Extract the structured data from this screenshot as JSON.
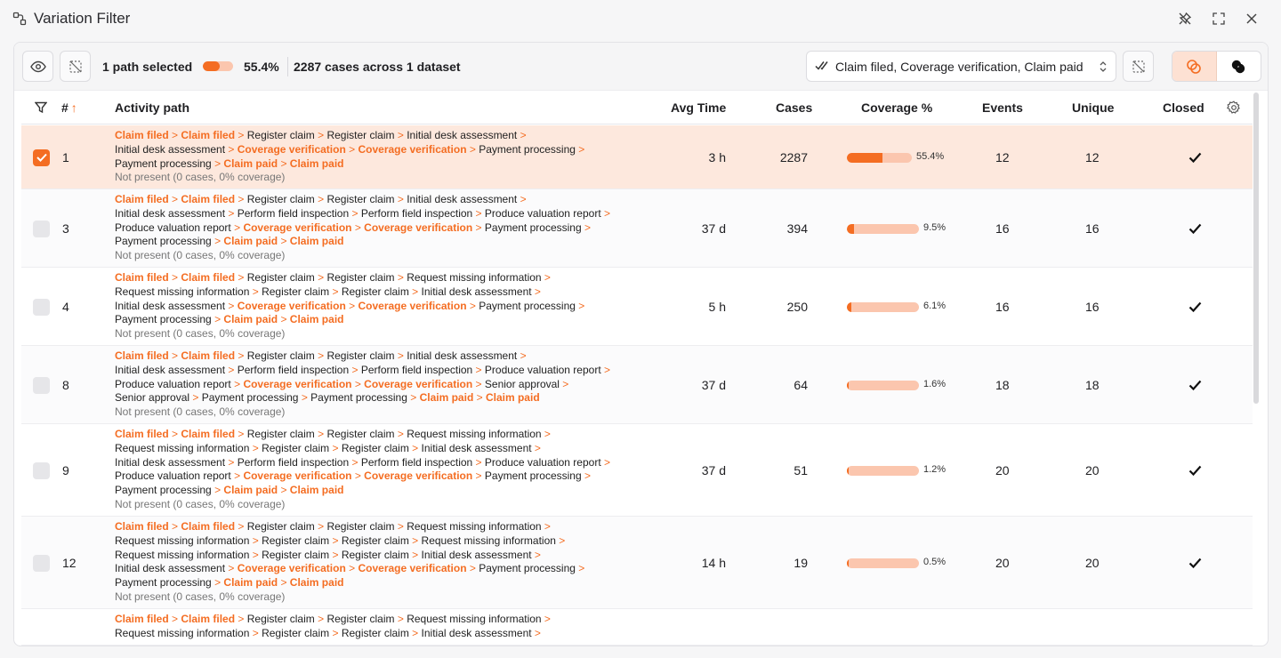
{
  "window": {
    "title": "Variation Filter"
  },
  "toolbar": {
    "selection": "1 path selected",
    "selection_fraction": 0.554,
    "percent": "55.4%",
    "cases_summary": "2287 cases across 1 dataset",
    "activity_filter": "Claim filed, Coverage verification, Claim paid"
  },
  "columns": {
    "num": "#",
    "path": "Activity path",
    "avg": "Avg Time",
    "cases": "Cases",
    "coverage": "Coverage %",
    "events": "Events",
    "unique": "Unique",
    "closed": "Closed"
  },
  "colors": {
    "accent": "#f46d22",
    "accent_light": "#fbc6ae",
    "selected_row": "#fde8dd"
  },
  "rows": [
    {
      "num": "1",
      "avg": "3 h",
      "cases": "2287",
      "coverage": "55.4%",
      "coverage_fraction": 0.554,
      "events": "12",
      "unique": "12",
      "checked": true,
      "path_lines": [
        [
          [
            "o",
            "Claim filed"
          ],
          [
            "g",
            " > "
          ],
          [
            "o",
            "Claim filed"
          ],
          [
            "g",
            " > "
          ],
          [
            "n",
            "Register claim"
          ],
          [
            "g",
            " > "
          ],
          [
            "n",
            "Register claim"
          ],
          [
            "g",
            " > "
          ],
          [
            "n",
            "Initial desk assessment"
          ],
          [
            "g",
            " >"
          ]
        ],
        [
          [
            "n",
            "Initial desk assessment"
          ],
          [
            "g",
            " > "
          ],
          [
            "o",
            "Coverage verification"
          ],
          [
            "g",
            " > "
          ],
          [
            "o",
            "Coverage verification"
          ],
          [
            "g",
            " > "
          ],
          [
            "n",
            "Payment processing"
          ],
          [
            "g",
            " >"
          ]
        ],
        [
          [
            "n",
            "Payment processing"
          ],
          [
            "g",
            " > "
          ],
          [
            "o",
            "Claim paid"
          ],
          [
            "g",
            " > "
          ],
          [
            "o",
            "Claim paid"
          ]
        ]
      ],
      "not_present": "Not present (0 cases, 0% coverage)"
    },
    {
      "num": "3",
      "avg": "37 d",
      "cases": "394",
      "coverage": "9.5%",
      "coverage_fraction": 0.095,
      "events": "16",
      "unique": "16",
      "checked": false,
      "path_lines": [
        [
          [
            "o",
            "Claim filed"
          ],
          [
            "g",
            " > "
          ],
          [
            "o",
            "Claim filed"
          ],
          [
            "g",
            " > "
          ],
          [
            "n",
            "Register claim"
          ],
          [
            "g",
            " > "
          ],
          [
            "n",
            "Register claim"
          ],
          [
            "g",
            " > "
          ],
          [
            "n",
            "Initial desk assessment"
          ],
          [
            "g",
            " >"
          ]
        ],
        [
          [
            "n",
            "Initial desk assessment"
          ],
          [
            "g",
            " > "
          ],
          [
            "n",
            "Perform field inspection"
          ],
          [
            "g",
            " > "
          ],
          [
            "n",
            "Perform field inspection"
          ],
          [
            "g",
            " > "
          ],
          [
            "n",
            "Produce valuation report"
          ],
          [
            "g",
            " >"
          ]
        ],
        [
          [
            "n",
            "Produce valuation report"
          ],
          [
            "g",
            " > "
          ],
          [
            "o",
            "Coverage verification"
          ],
          [
            "g",
            " > "
          ],
          [
            "o",
            "Coverage verification"
          ],
          [
            "g",
            " > "
          ],
          [
            "n",
            "Payment processing"
          ],
          [
            "g",
            " >"
          ]
        ],
        [
          [
            "n",
            "Payment processing"
          ],
          [
            "g",
            " > "
          ],
          [
            "o",
            "Claim paid"
          ],
          [
            "g",
            " > "
          ],
          [
            "o",
            "Claim paid"
          ]
        ]
      ],
      "not_present": "Not present (0 cases, 0% coverage)"
    },
    {
      "num": "4",
      "avg": "5 h",
      "cases": "250",
      "coverage": "6.1%",
      "coverage_fraction": 0.061,
      "events": "16",
      "unique": "16",
      "checked": false,
      "path_lines": [
        [
          [
            "o",
            "Claim filed"
          ],
          [
            "g",
            " > "
          ],
          [
            "o",
            "Claim filed"
          ],
          [
            "g",
            " > "
          ],
          [
            "n",
            "Register claim"
          ],
          [
            "g",
            " > "
          ],
          [
            "n",
            "Register claim"
          ],
          [
            "g",
            " > "
          ],
          [
            "n",
            "Request missing information"
          ],
          [
            "g",
            " >"
          ]
        ],
        [
          [
            "n",
            "Request missing information"
          ],
          [
            "g",
            " > "
          ],
          [
            "n",
            "Register claim"
          ],
          [
            "g",
            " > "
          ],
          [
            "n",
            "Register claim"
          ],
          [
            "g",
            " > "
          ],
          [
            "n",
            "Initial desk assessment"
          ],
          [
            "g",
            " >"
          ]
        ],
        [
          [
            "n",
            "Initial desk assessment"
          ],
          [
            "g",
            " > "
          ],
          [
            "o",
            "Coverage verification"
          ],
          [
            "g",
            " > "
          ],
          [
            "o",
            "Coverage verification"
          ],
          [
            "g",
            " > "
          ],
          [
            "n",
            "Payment processing"
          ],
          [
            "g",
            " >"
          ]
        ],
        [
          [
            "n",
            "Payment processing"
          ],
          [
            "g",
            " > "
          ],
          [
            "o",
            "Claim paid"
          ],
          [
            "g",
            " > "
          ],
          [
            "o",
            "Claim paid"
          ]
        ]
      ],
      "not_present": "Not present (0 cases, 0% coverage)"
    },
    {
      "num": "8",
      "avg": "37 d",
      "cases": "64",
      "coverage": "1.6%",
      "coverage_fraction": 0.016,
      "events": "18",
      "unique": "18",
      "checked": false,
      "path_lines": [
        [
          [
            "o",
            "Claim filed"
          ],
          [
            "g",
            " > "
          ],
          [
            "o",
            "Claim filed"
          ],
          [
            "g",
            " > "
          ],
          [
            "n",
            "Register claim"
          ],
          [
            "g",
            " > "
          ],
          [
            "n",
            "Register claim"
          ],
          [
            "g",
            " > "
          ],
          [
            "n",
            "Initial desk assessment"
          ],
          [
            "g",
            " >"
          ]
        ],
        [
          [
            "n",
            "Initial desk assessment"
          ],
          [
            "g",
            " > "
          ],
          [
            "n",
            "Perform field inspection"
          ],
          [
            "g",
            " > "
          ],
          [
            "n",
            "Perform field inspection"
          ],
          [
            "g",
            " > "
          ],
          [
            "n",
            "Produce valuation report"
          ],
          [
            "g",
            " >"
          ]
        ],
        [
          [
            "n",
            "Produce valuation report"
          ],
          [
            "g",
            " > "
          ],
          [
            "o",
            "Coverage verification"
          ],
          [
            "g",
            " > "
          ],
          [
            "o",
            "Coverage verification"
          ],
          [
            "g",
            " > "
          ],
          [
            "n",
            "Senior approval"
          ],
          [
            "g",
            " >"
          ]
        ],
        [
          [
            "n",
            "Senior approval"
          ],
          [
            "g",
            " > "
          ],
          [
            "n",
            "Payment processing"
          ],
          [
            "g",
            " > "
          ],
          [
            "n",
            "Payment processing"
          ],
          [
            "g",
            " > "
          ],
          [
            "o",
            "Claim paid"
          ],
          [
            "g",
            " > "
          ],
          [
            "o",
            "Claim paid"
          ]
        ]
      ],
      "not_present": "Not present (0 cases, 0% coverage)"
    },
    {
      "num": "9",
      "avg": "37 d",
      "cases": "51",
      "coverage": "1.2%",
      "coverage_fraction": 0.012,
      "events": "20",
      "unique": "20",
      "checked": false,
      "path_lines": [
        [
          [
            "o",
            "Claim filed"
          ],
          [
            "g",
            " > "
          ],
          [
            "o",
            "Claim filed"
          ],
          [
            "g",
            " > "
          ],
          [
            "n",
            "Register claim"
          ],
          [
            "g",
            " > "
          ],
          [
            "n",
            "Register claim"
          ],
          [
            "g",
            " > "
          ],
          [
            "n",
            "Request missing information"
          ],
          [
            "g",
            " >"
          ]
        ],
        [
          [
            "n",
            "Request missing information"
          ],
          [
            "g",
            " > "
          ],
          [
            "n",
            "Register claim"
          ],
          [
            "g",
            " > "
          ],
          [
            "n",
            "Register claim"
          ],
          [
            "g",
            " > "
          ],
          [
            "n",
            "Initial desk assessment"
          ],
          [
            "g",
            " >"
          ]
        ],
        [
          [
            "n",
            "Initial desk assessment"
          ],
          [
            "g",
            " > "
          ],
          [
            "n",
            "Perform field inspection"
          ],
          [
            "g",
            " > "
          ],
          [
            "n",
            "Perform field inspection"
          ],
          [
            "g",
            " > "
          ],
          [
            "n",
            "Produce valuation report"
          ],
          [
            "g",
            " >"
          ]
        ],
        [
          [
            "n",
            "Produce valuation report"
          ],
          [
            "g",
            " > "
          ],
          [
            "o",
            "Coverage verification"
          ],
          [
            "g",
            " > "
          ],
          [
            "o",
            "Coverage verification"
          ],
          [
            "g",
            " > "
          ],
          [
            "n",
            "Payment processing"
          ],
          [
            "g",
            " >"
          ]
        ],
        [
          [
            "n",
            "Payment processing"
          ],
          [
            "g",
            " > "
          ],
          [
            "o",
            "Claim paid"
          ],
          [
            "g",
            " > "
          ],
          [
            "o",
            "Claim paid"
          ]
        ]
      ],
      "not_present": "Not present (0 cases, 0% coverage)"
    },
    {
      "num": "12",
      "avg": "14 h",
      "cases": "19",
      "coverage": "0.5%",
      "coverage_fraction": 0.005,
      "events": "20",
      "unique": "20",
      "checked": false,
      "path_lines": [
        [
          [
            "o",
            "Claim filed"
          ],
          [
            "g",
            " > "
          ],
          [
            "o",
            "Claim filed"
          ],
          [
            "g",
            " > "
          ],
          [
            "n",
            "Register claim"
          ],
          [
            "g",
            " > "
          ],
          [
            "n",
            "Register claim"
          ],
          [
            "g",
            " > "
          ],
          [
            "n",
            "Request missing information"
          ],
          [
            "g",
            " >"
          ]
        ],
        [
          [
            "n",
            "Request missing information"
          ],
          [
            "g",
            " > "
          ],
          [
            "n",
            "Register claim"
          ],
          [
            "g",
            " > "
          ],
          [
            "n",
            "Register claim"
          ],
          [
            "g",
            " > "
          ],
          [
            "n",
            "Request missing information"
          ],
          [
            "g",
            " >"
          ]
        ],
        [
          [
            "n",
            "Request missing information"
          ],
          [
            "g",
            " > "
          ],
          [
            "n",
            "Register claim"
          ],
          [
            "g",
            " > "
          ],
          [
            "n",
            "Register claim"
          ],
          [
            "g",
            " > "
          ],
          [
            "n",
            "Initial desk assessment"
          ],
          [
            "g",
            " >"
          ]
        ],
        [
          [
            "n",
            "Initial desk assessment"
          ],
          [
            "g",
            " > "
          ],
          [
            "o",
            "Coverage verification"
          ],
          [
            "g",
            " > "
          ],
          [
            "o",
            "Coverage verification"
          ],
          [
            "g",
            " > "
          ],
          [
            "n",
            "Payment processing"
          ],
          [
            "g",
            " >"
          ]
        ],
        [
          [
            "n",
            "Payment processing"
          ],
          [
            "g",
            " > "
          ],
          [
            "o",
            "Claim paid"
          ],
          [
            "g",
            " > "
          ],
          [
            "o",
            "Claim paid"
          ]
        ]
      ],
      "not_present": "Not present (0 cases, 0% coverage)"
    },
    {
      "num": "",
      "avg": "",
      "cases": "",
      "coverage": "",
      "coverage_fraction": null,
      "events": "",
      "unique": "",
      "checked": false,
      "partial": true,
      "path_lines": [
        [
          [
            "o",
            "Claim filed"
          ],
          [
            "g",
            " > "
          ],
          [
            "o",
            "Claim filed"
          ],
          [
            "g",
            " > "
          ],
          [
            "n",
            "Register claim"
          ],
          [
            "g",
            " > "
          ],
          [
            "n",
            "Register claim"
          ],
          [
            "g",
            " > "
          ],
          [
            "n",
            "Request missing information"
          ],
          [
            "g",
            " >"
          ]
        ],
        [
          [
            "n",
            "Request missing information"
          ],
          [
            "g",
            " > "
          ],
          [
            "n",
            "Register claim"
          ],
          [
            "g",
            " > "
          ],
          [
            "n",
            "Register claim"
          ],
          [
            "g",
            " > "
          ],
          [
            "n",
            "Initial desk assessment"
          ],
          [
            "g",
            " >"
          ]
        ]
      ],
      "not_present": ""
    }
  ]
}
